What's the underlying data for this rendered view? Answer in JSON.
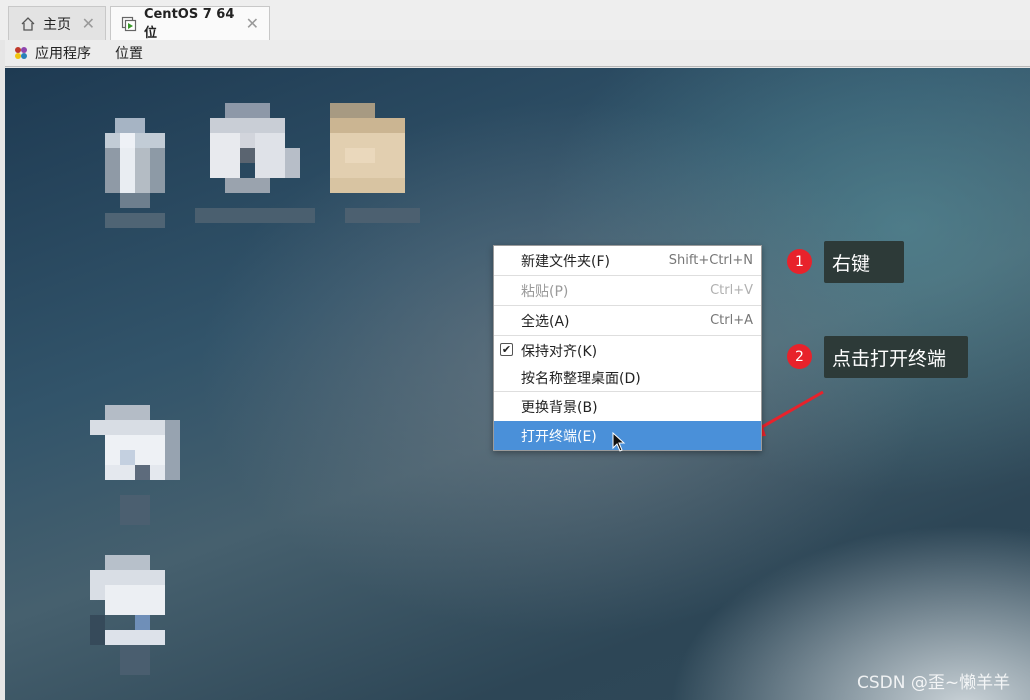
{
  "tabs": [
    {
      "label": "主页",
      "icon": "home-icon"
    },
    {
      "label": "CentOS 7 64 位",
      "icon": "vm-play-icon"
    }
  ],
  "menubar": {
    "applications": "应用程序",
    "places": "位置"
  },
  "context_menu": {
    "items": [
      {
        "label": "新建文件夹(F)",
        "shortcut": "Shift+Ctrl+N"
      },
      {
        "label": "粘贴(P)",
        "shortcut": "Ctrl+V",
        "disabled": true
      },
      {
        "label": "全选(A)",
        "shortcut": "Ctrl+A"
      },
      {
        "label": "保持对齐(K)",
        "checked": true
      },
      {
        "label": "按名称整理桌面(D)"
      },
      {
        "label": "更换背景(B)"
      },
      {
        "label": "打开终端(E)",
        "selected": true
      }
    ]
  },
  "annotations": [
    {
      "number": "1",
      "text": "右键"
    },
    {
      "number": "2",
      "text": "点击打开终端"
    }
  ],
  "watermark": "CSDN @歪~懒羊羊",
  "colors": {
    "highlight": "#4a90d9",
    "badge": "#e8222b",
    "callout_bg": "#2d3a38",
    "arrow": "#e8222b"
  }
}
